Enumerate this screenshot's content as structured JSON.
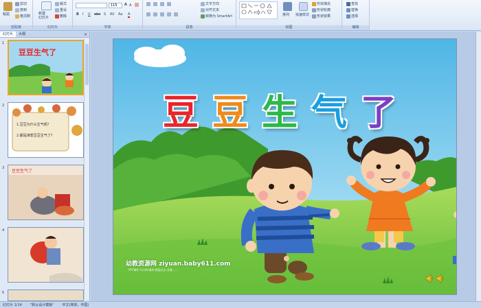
{
  "ribbon": {
    "clipboard": {
      "label": "剪贴板",
      "paste": "粘贴",
      "cut": "剪切",
      "copy": "复制",
      "format_painter": "格式刷"
    },
    "slides": {
      "label": "幻灯片",
      "new_slide": "新建\n幻灯片",
      "layout": "版式",
      "reset": "重设",
      "delete": "删除"
    },
    "font": {
      "label": "字体",
      "size_value": "115",
      "font_value": ""
    },
    "paragraph": {
      "label": "段落",
      "text_direction": "文字方向",
      "align_text": "对齐文本",
      "smartart": "转换为 SmartArt"
    },
    "drawing": {
      "label": "绘图",
      "arrange": "排列",
      "quick_styles": "快速样式",
      "shape_fill": "形状填充",
      "shape_outline": "形状轮廓",
      "shape_effects": "形状效果"
    },
    "editing": {
      "label": "编辑",
      "find": "查找",
      "replace": "替换",
      "select": "选择"
    }
  },
  "pane": {
    "tab_slides": "幻灯片",
    "tab_outline": "大纲",
    "close": "×",
    "slide_numbers": [
      "1",
      "2",
      "3",
      "4",
      "5"
    ],
    "thumb1_title": "豆豆生气了",
    "thumb2_lines": [
      "1.豆豆为什么生气呢?",
      "2.都是谁惹豆豆生气了?"
    ],
    "thumb3_title": "豆豆生气了"
  },
  "slide": {
    "title_chars": [
      "豆",
      "豆",
      "生",
      "气",
      "了"
    ],
    "title_colors": [
      "#e8252a",
      "#f08a1c",
      "#2eb84a",
      "#1a9ee0",
      "#7b3fc6"
    ],
    "watermark": "幼教资源网 ziyuan.baby611.com",
    "watermark_sub": "PPT课件 FLASH课件 教案论文 试卷……"
  },
  "status": {
    "slide_info": "幻灯片 1/14",
    "theme": "\"默认设计模板\"",
    "language": "中文(简体，中国)"
  }
}
